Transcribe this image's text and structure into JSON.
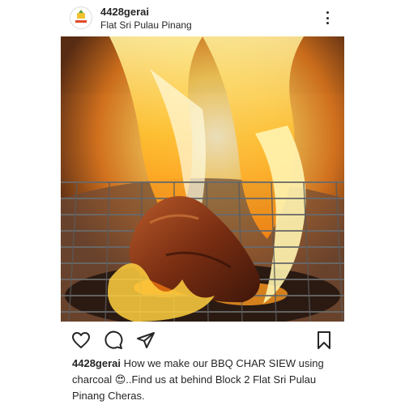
{
  "post": {
    "username": "4428gerai",
    "location": "Flat Sri Pulau Pinang",
    "avatar_logo_text": "4428 GERAI",
    "caption_username": "4428gerai",
    "caption_text": "How we make our BBQ CHAR SIEW using charcoal 😍..Find us at behind Block 2 Flat Sri Pulau Pinang Cheras."
  },
  "icons": {
    "more": "more-vertical-icon",
    "like": "heart-icon",
    "comment": "comment-icon",
    "share": "paper-plane-icon",
    "save": "bookmark-icon"
  },
  "colors": {
    "text": "#262626",
    "flame": "#ffb31a",
    "meat": "#8a3a1a"
  }
}
